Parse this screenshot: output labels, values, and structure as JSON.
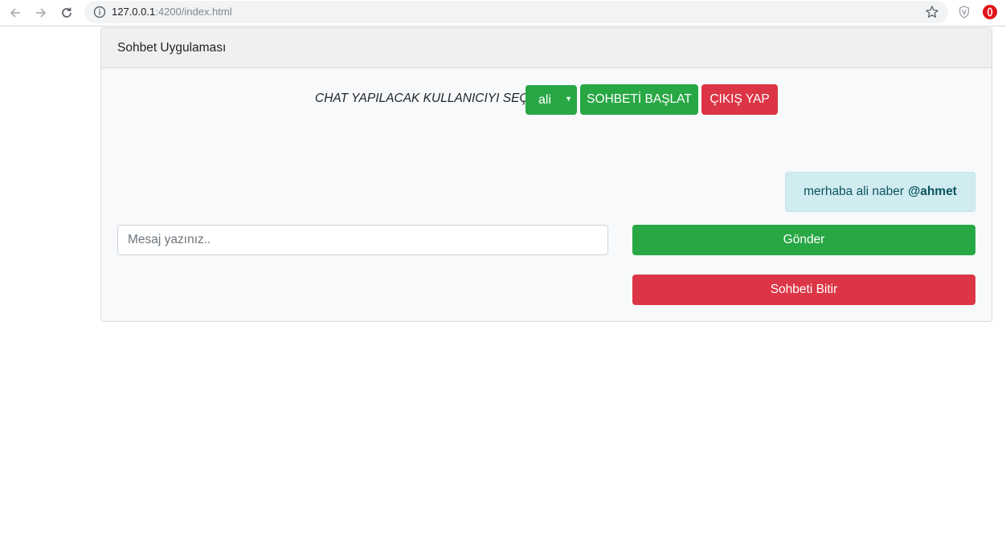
{
  "browser": {
    "url_host": "127.0.0.1",
    "url_path": ":4200/index.html",
    "icons": [
      "back-arrow-icon",
      "forward-arrow-icon",
      "reload-icon",
      "info-icon",
      "star-icon",
      "shield-extension-icon",
      "opera-extension-icon"
    ]
  },
  "app": {
    "title": "Sohbet Uygulaması",
    "select_label": "CHAT YAPILACAK KULLANICIYI SEÇ",
    "selected_user": "ali",
    "start_button": "SOHBETİ BAŞLAT",
    "logout_button": "ÇIKIŞ YAP",
    "message": {
      "text": "merhaba ali naber",
      "mention": "@ahmet"
    },
    "input_placeholder": "Mesaj yazınız..",
    "input_value": "",
    "send_button": "Gönder",
    "end_button": "Sohbeti Bitir"
  },
  "colors": {
    "success": "#28a745",
    "danger": "#dc3545",
    "info_bg": "#d1ecf1",
    "info_text": "#0c5460"
  }
}
